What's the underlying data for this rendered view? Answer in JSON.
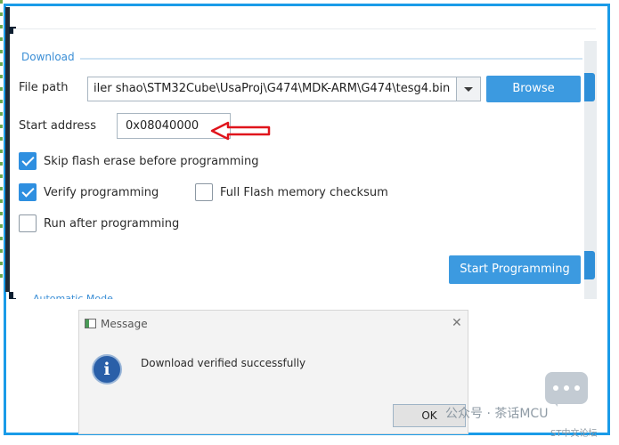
{
  "download": {
    "section_title": "Download",
    "file_path_label": "File path",
    "file_path_value": "iler shao\\STM32Cube\\UsaProj\\G474\\MDK-ARM\\G474\\tesg4.bin",
    "browse_label": "Browse",
    "start_address_label": "Start address",
    "start_address_value": "0x08040000",
    "options": [
      {
        "label": "Skip flash erase before programming",
        "checked": true
      },
      {
        "label": "Verify programming",
        "checked": true
      },
      {
        "label": "Full Flash memory checksum",
        "checked": false
      },
      {
        "label": "Run after programming",
        "checked": false
      }
    ],
    "start_programming_label": "Start Programming"
  },
  "automatic_mode": {
    "section_title": "Automatic Mode"
  },
  "message_dialog": {
    "title": "Message",
    "close_glyph": "✕",
    "icon_glyph": "i",
    "text": "Download verified successfully",
    "ok_label": "OK"
  },
  "watermark": {
    "text": "公众号 · 茶话MCU",
    "small_text": "ST中文论坛"
  },
  "colors": {
    "frame_border": "#1a9be8",
    "accent_blue": "#3c9ae0",
    "annotation_arrow": "#e0141c"
  }
}
